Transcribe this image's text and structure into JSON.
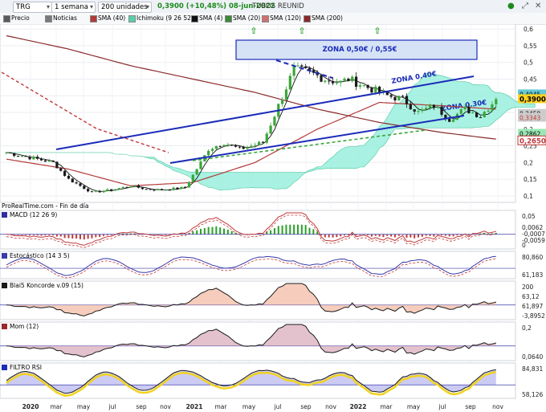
{
  "toolbar": {
    "symbol": "TRG",
    "period": "1 semana",
    "units": "200 unidades",
    "quote": "0,3900 (+10,48%) 08-jun-2022",
    "instrument": "TUBOS REUNID"
  },
  "legend": {
    "items": [
      {
        "label": "Precio",
        "color": "#5a5a5a"
      },
      {
        "label": "Noticias",
        "color": "#7a7a7a"
      },
      {
        "label": "SMA (40)",
        "color": "#b33a3a"
      },
      {
        "label": "Ichimoku (9 26 52)",
        "color": "#58d0a8"
      },
      {
        "label": "SMA (4)",
        "color": "#111111"
      },
      {
        "label": "SMA (20)",
        "color": "#3a8a3a"
      },
      {
        "label": "SMA (120)",
        "color": "#d07070"
      },
      {
        "label": "SMA (200)",
        "color": "#8a2a2a"
      }
    ]
  },
  "watermark": "ProRealTime.com - Fin de día",
  "colors": {
    "up": "#3aa63a",
    "down": "#1a1a1a",
    "trend": "#1b2bb8",
    "cloud": "#9aeedd",
    "sma40": "#b33a3a",
    "sma200": "#8a2a2a",
    "price_box": "#ffd21e"
  },
  "annotations": {
    "zona1": "ZONA 0,50€ / 0,55€",
    "zona2": "ZONA 0.40€",
    "zona3": "ZONA 0.30€"
  },
  "price_labels": [
    "0,4045",
    "0,3900",
    "0,3459",
    "0,3343",
    "0,2862",
    "0,2650"
  ],
  "chart_data": {
    "type": "line",
    "title": "TRG 1 semana",
    "x_ticks": [
      "2020",
      "mar",
      "may",
      "jul",
      "sep",
      "nov",
      "2021",
      "mar",
      "may",
      "jul",
      "sep",
      "nov",
      "2022",
      "mar",
      "may",
      "jul",
      "sep",
      "nov"
    ],
    "y_ticks": [
      "0,6",
      "0,55",
      "0,5",
      "0,45",
      "0,4",
      "0,35",
      "0,3",
      "0,25",
      "0,2",
      "0,15",
      "0,1"
    ],
    "ylim": [
      0.09,
      0.61
    ],
    "series": [
      {
        "name": "Precio",
        "x": [
          0,
          4,
          8,
          12,
          16,
          22,
          28,
          32,
          36,
          40,
          46,
          50,
          52,
          56,
          60,
          63,
          66,
          70,
          74,
          78,
          82,
          86,
          88,
          92,
          96,
          98,
          102,
          106,
          110,
          114,
          118,
          122,
          126
        ],
        "y": [
          0.23,
          0.22,
          0.21,
          0.2,
          0.15,
          0.11,
          0.12,
          0.13,
          0.12,
          0.118,
          0.125,
          0.2,
          0.24,
          0.26,
          0.24,
          0.25,
          0.26,
          0.37,
          0.48,
          0.47,
          0.45,
          0.44,
          0.45,
          0.43,
          0.41,
          0.4,
          0.39,
          0.35,
          0.37,
          0.33,
          0.36,
          0.34,
          0.39
        ]
      },
      {
        "name": "SMA (40)",
        "x": [
          0,
          16,
          32,
          48,
          64,
          80,
          96,
          112,
          126
        ],
        "y": [
          0.21,
          0.18,
          0.13,
          0.14,
          0.2,
          0.3,
          0.38,
          0.37,
          0.36
        ]
      },
      {
        "name": "SMA (200)",
        "x": [
          0,
          16,
          32,
          48,
          64,
          80,
          96,
          112,
          126
        ],
        "y": [
          0.58,
          0.54,
          0.49,
          0.45,
          0.41,
          0.36,
          0.32,
          0.29,
          0.27
        ]
      }
    ],
    "panels": [
      {
        "name": "MACD (12 26 9)",
        "ticks": [
          "0,05",
          "0"
        ],
        "values": [
          "0,0062",
          "-0,0007",
          "-0,0059"
        ]
      },
      {
        "name": "Estocástico (14 3 5)",
        "ticks": [
          "80,860",
          "61,183"
        ]
      },
      {
        "name": "Blai5 Koncorde v.09 (15)",
        "ticks": [
          "200",
          "63,12",
          "61,897",
          "-3,8952"
        ]
      },
      {
        "name": "Mom (12)",
        "ticks": [
          "0,2",
          "0,0640"
        ]
      },
      {
        "name": "FILTRO RSI",
        "ticks": [
          "84,831",
          "58,126"
        ]
      }
    ]
  }
}
